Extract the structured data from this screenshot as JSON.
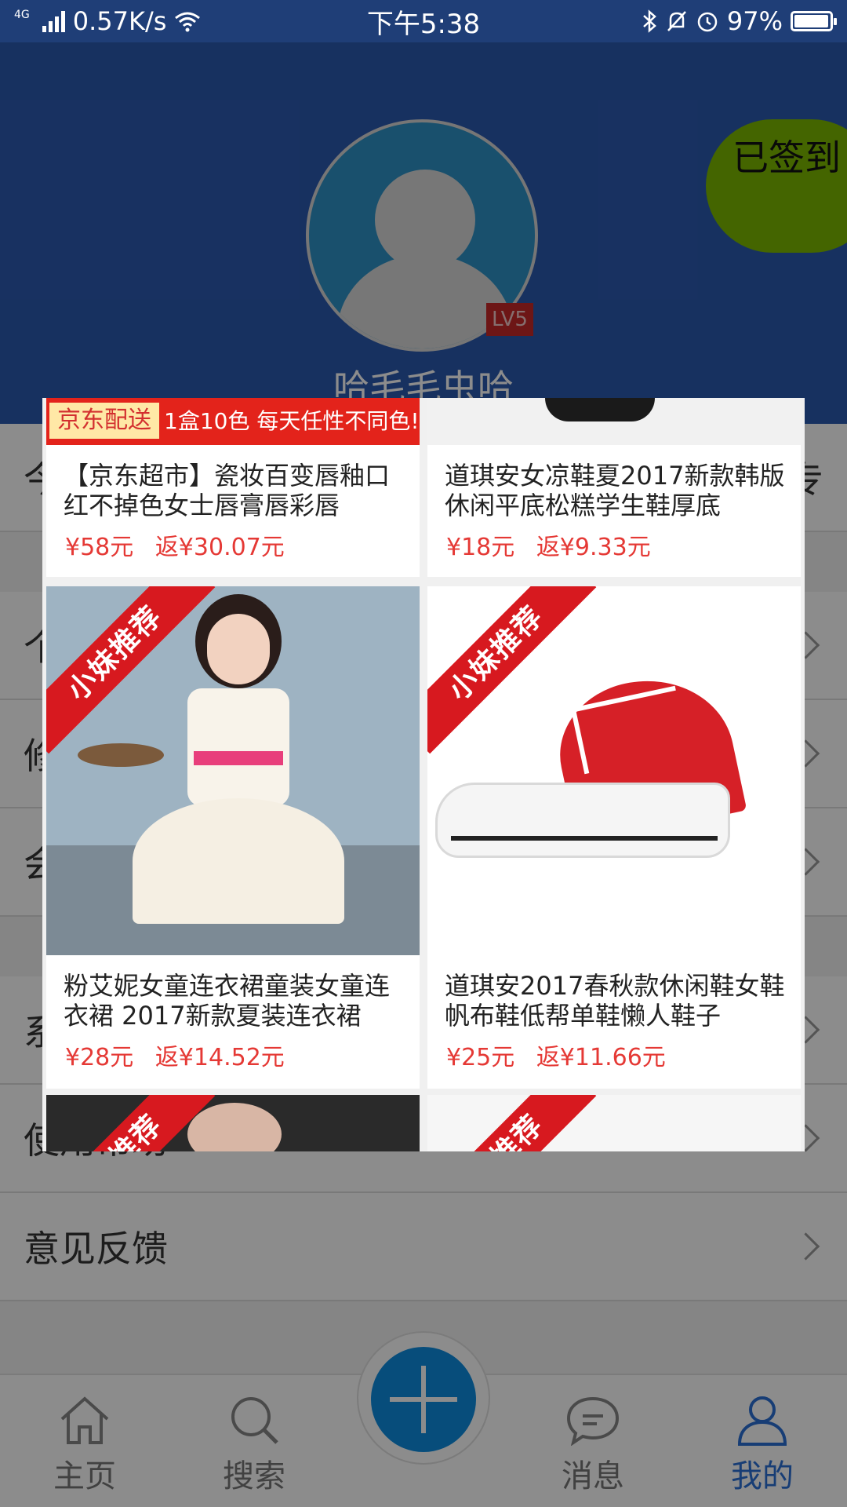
{
  "status_bar": {
    "network_type": "4G",
    "speed": "0.57K/s",
    "time": "下午5:38",
    "battery": "97%",
    "battery_level": 0.97
  },
  "profile": {
    "level_badge": "LV5",
    "username": "哈毛毛虫哈",
    "signin_label": "已签到"
  },
  "menu": {
    "row1": "今",
    "row1_right": "专",
    "row2": "个",
    "row3": "修",
    "row4": "会",
    "row5": "系",
    "help": "使用帮助",
    "feedback": "意见反馈"
  },
  "popup": {
    "cards": [
      {
        "banner_tag": "京东配送",
        "banner_text": "1盒10色 每天任性不同色!",
        "title": "【京东超市】瓷妆百变唇釉口红不掉色女士唇膏唇彩唇",
        "price": "¥58元",
        "rebate": "返¥30.07元"
      },
      {
        "title": "道琪安女凉鞋夏2017新款韩版休闲平底松糕学生鞋厚底",
        "price": "¥18元",
        "rebate": "返¥9.33元"
      },
      {
        "ribbon": "小妹推荐",
        "title": "粉艾妮女童连衣裙童装女童连衣裙 2017新款夏装连衣裙",
        "price": "¥28元",
        "rebate": "返¥14.52元"
      },
      {
        "ribbon": "小妹推荐",
        "title": "道琪安2017春秋款休闲鞋女鞋帆布鞋低帮单鞋懒人鞋子",
        "price": "¥25元",
        "rebate": "返¥11.66元"
      },
      {
        "ribbon": "小妹推荐"
      },
      {
        "ribbon": "小妹推荐"
      }
    ]
  },
  "bottom_nav": {
    "home": "主页",
    "search": "搜索",
    "messages": "消息",
    "mine": "我的",
    "active_color": "#2b6fd6"
  },
  "colors": {
    "status_bar_bg": "#1f3e77",
    "header_bg": "#2b5ab0",
    "signin_bg": "#7cb800",
    "price_red": "#e53935",
    "fab_blue": "#0e8de1"
  }
}
